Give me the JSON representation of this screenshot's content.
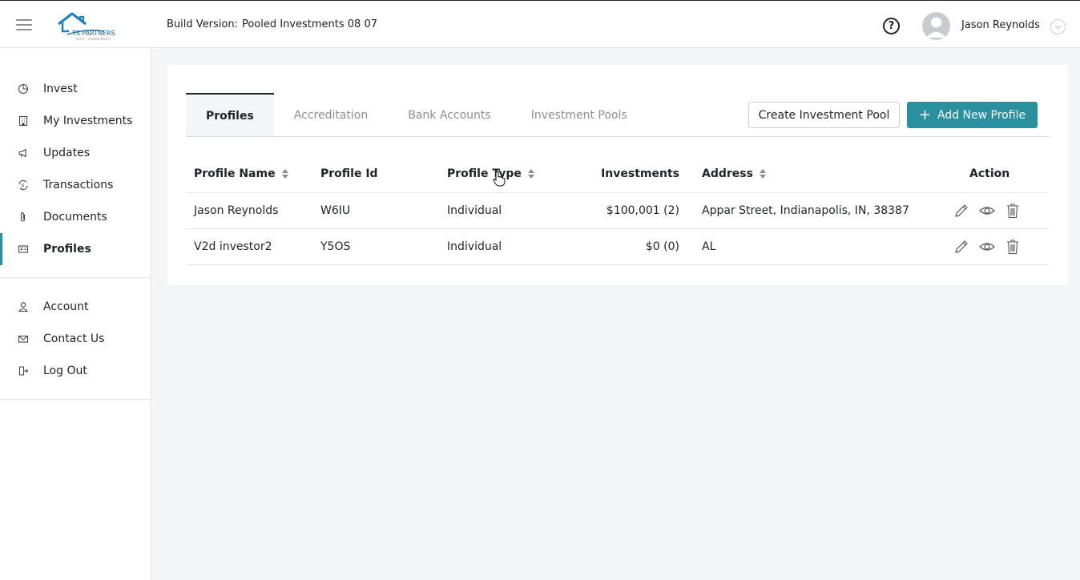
{
  "header": {
    "logo_text": "TS PARTNERS",
    "logo_tagline": "TRUST · TRANSPARENCY",
    "build_label": "Build Version:",
    "build_value": "Pooled Investments 08 07",
    "help_icon_glyph": "?",
    "user_name": "Jason Reynolds"
  },
  "sidebar": {
    "main_items": [
      {
        "label": "Invest",
        "icon": "pie-chart-icon"
      },
      {
        "label": "My Investments",
        "icon": "building-icon"
      },
      {
        "label": "Updates",
        "icon": "megaphone-icon"
      },
      {
        "label": "Transactions",
        "icon": "dollar-exchange-icon"
      },
      {
        "label": "Documents",
        "icon": "paperclip-icon"
      },
      {
        "label": "Profiles",
        "icon": "id-card-icon",
        "active": true
      }
    ],
    "secondary_items": [
      {
        "label": "Account",
        "icon": "user-icon"
      },
      {
        "label": "Contact Us",
        "icon": "envelope-icon"
      },
      {
        "label": "Log Out",
        "icon": "logout-icon"
      }
    ]
  },
  "tabs": [
    {
      "label": "Profiles",
      "active": true
    },
    {
      "label": "Accreditation"
    },
    {
      "label": "Bank Accounts"
    },
    {
      "label": "Investment Pools"
    }
  ],
  "buttons": {
    "create_pool": "Create Investment Pool",
    "add_profile_plus": "+",
    "add_profile": "Add New Profile"
  },
  "table": {
    "columns": [
      "Profile Name",
      "Profile Id",
      "Profile Type",
      "Investments",
      "Address",
      "Action"
    ],
    "rows": [
      {
        "name": "Jason Reynolds",
        "id": "W6IU",
        "type": "Individual",
        "investments": "$100,001 (2)",
        "address": "Appar Street, Indianapolis, IN, 38387"
      },
      {
        "name": "V2d investor2",
        "id": "Y5OS",
        "type": "Individual",
        "investments": "$0 (0)",
        "address": "AL"
      }
    ]
  },
  "colors": {
    "accent": "#2a8f9e",
    "text": "#1f2328",
    "muted": "#8a8f96"
  }
}
